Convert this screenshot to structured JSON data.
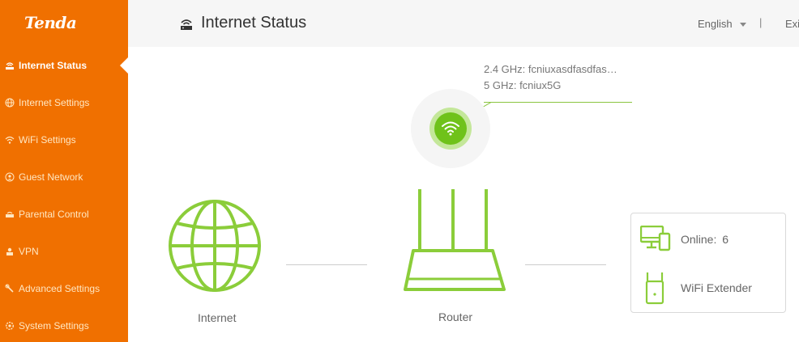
{
  "brand": {
    "logo": "Tenda",
    "accent": "#f07000",
    "green": "#6fc21a"
  },
  "sidebar": {
    "items": [
      {
        "label": "Internet Status",
        "icon": "router-icon",
        "active": true
      },
      {
        "label": "Internet Settings",
        "icon": "globe-icon",
        "active": false
      },
      {
        "label": "WiFi Settings",
        "icon": "wifi-icon",
        "active": false
      },
      {
        "label": "Guest Network",
        "icon": "guest-icon",
        "active": false
      },
      {
        "label": "Parental Control",
        "icon": "parental-icon",
        "active": false
      },
      {
        "label": "VPN",
        "icon": "vpn-icon",
        "active": false
      },
      {
        "label": "Advanced Settings",
        "icon": "wrench-icon",
        "active": false
      },
      {
        "label": "System Settings",
        "icon": "gear-icon",
        "active": false
      }
    ]
  },
  "header": {
    "title": "Internet Status",
    "language": "English",
    "separator": "|",
    "exit_label": "Exit"
  },
  "main": {
    "wifi": {
      "ssid_24": "2.4 GHz: fcniuxasdfasdfas…",
      "ssid_5": "5 GHz: fcniux5G"
    },
    "internet_label": "Internet",
    "router_label": "Router",
    "devices": {
      "online_label": "Online:",
      "online_count": "6",
      "extender_label": "WiFi Extender"
    }
  }
}
